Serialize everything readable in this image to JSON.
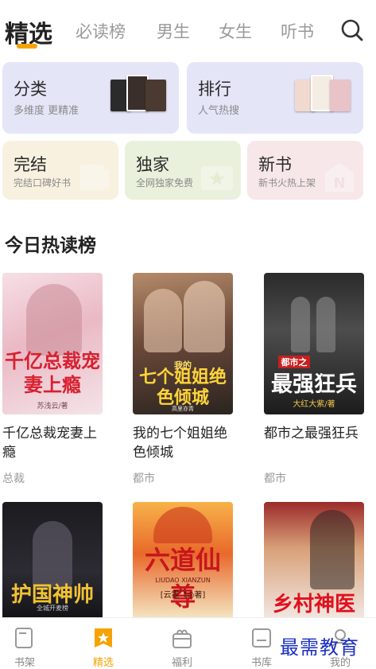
{
  "top_tabs": [
    {
      "label": "精选",
      "active": true
    },
    {
      "label": "必读榜",
      "active": false
    },
    {
      "label": "男生",
      "active": false
    },
    {
      "label": "女生",
      "active": false
    },
    {
      "label": "听书",
      "active": false
    }
  ],
  "categories": {
    "big": [
      {
        "title": "分类",
        "sub": "多维度 更精准"
      },
      {
        "title": "排行",
        "sub": "人气热搜"
      }
    ],
    "small": [
      {
        "title": "完结",
        "sub": "完结口碑好书"
      },
      {
        "title": "独家",
        "sub": "全网独家免费"
      },
      {
        "title": "新书",
        "sub": "新书火热上架"
      }
    ]
  },
  "section": {
    "title": "今日热读榜"
  },
  "books": [
    {
      "title": "千亿总裁宠妻上瘾",
      "tag": "总裁",
      "cover_text": "千亿总裁宠妻上瘾",
      "cover_author": "苏浅云/著"
    },
    {
      "title": "我的七个姐姐绝色倾城",
      "tag": "都市",
      "cover_text": "七个姐姐绝色倾城",
      "cover_small": "我的",
      "cover_author": "高里亦青"
    },
    {
      "title": "都市之最强狂兵",
      "tag": "都市",
      "cover_text": "最强狂兵",
      "cover_small": "都市之",
      "cover_author": "大红大紫/著"
    },
    {
      "cover_text": "护国神帅",
      "cover_small": "全城开麦榜"
    },
    {
      "cover_text": "六道仙尊",
      "cover_small": "LIUDAO XIANZUN",
      "cover_author": "[云霆飞◎著]"
    },
    {
      "cover_text": "乡村神医"
    }
  ],
  "bottom_nav": [
    {
      "label": "书架",
      "icon": "bookshelf-icon",
      "active": false
    },
    {
      "label": "精选",
      "icon": "featured-star-icon",
      "active": true
    },
    {
      "label": "福利",
      "icon": "gift-icon",
      "active": false
    },
    {
      "label": "书库",
      "icon": "library-icon",
      "active": false
    },
    {
      "label": "我的",
      "icon": "profile-icon",
      "active": false
    }
  ],
  "watermark": "最需教育",
  "colors": {
    "accent": "#f5a300",
    "card_blue": "#e4e5f7",
    "card_yellow": "#f8f1df",
    "card_green": "#e9f1dc",
    "card_pink": "#f8e7e8"
  }
}
